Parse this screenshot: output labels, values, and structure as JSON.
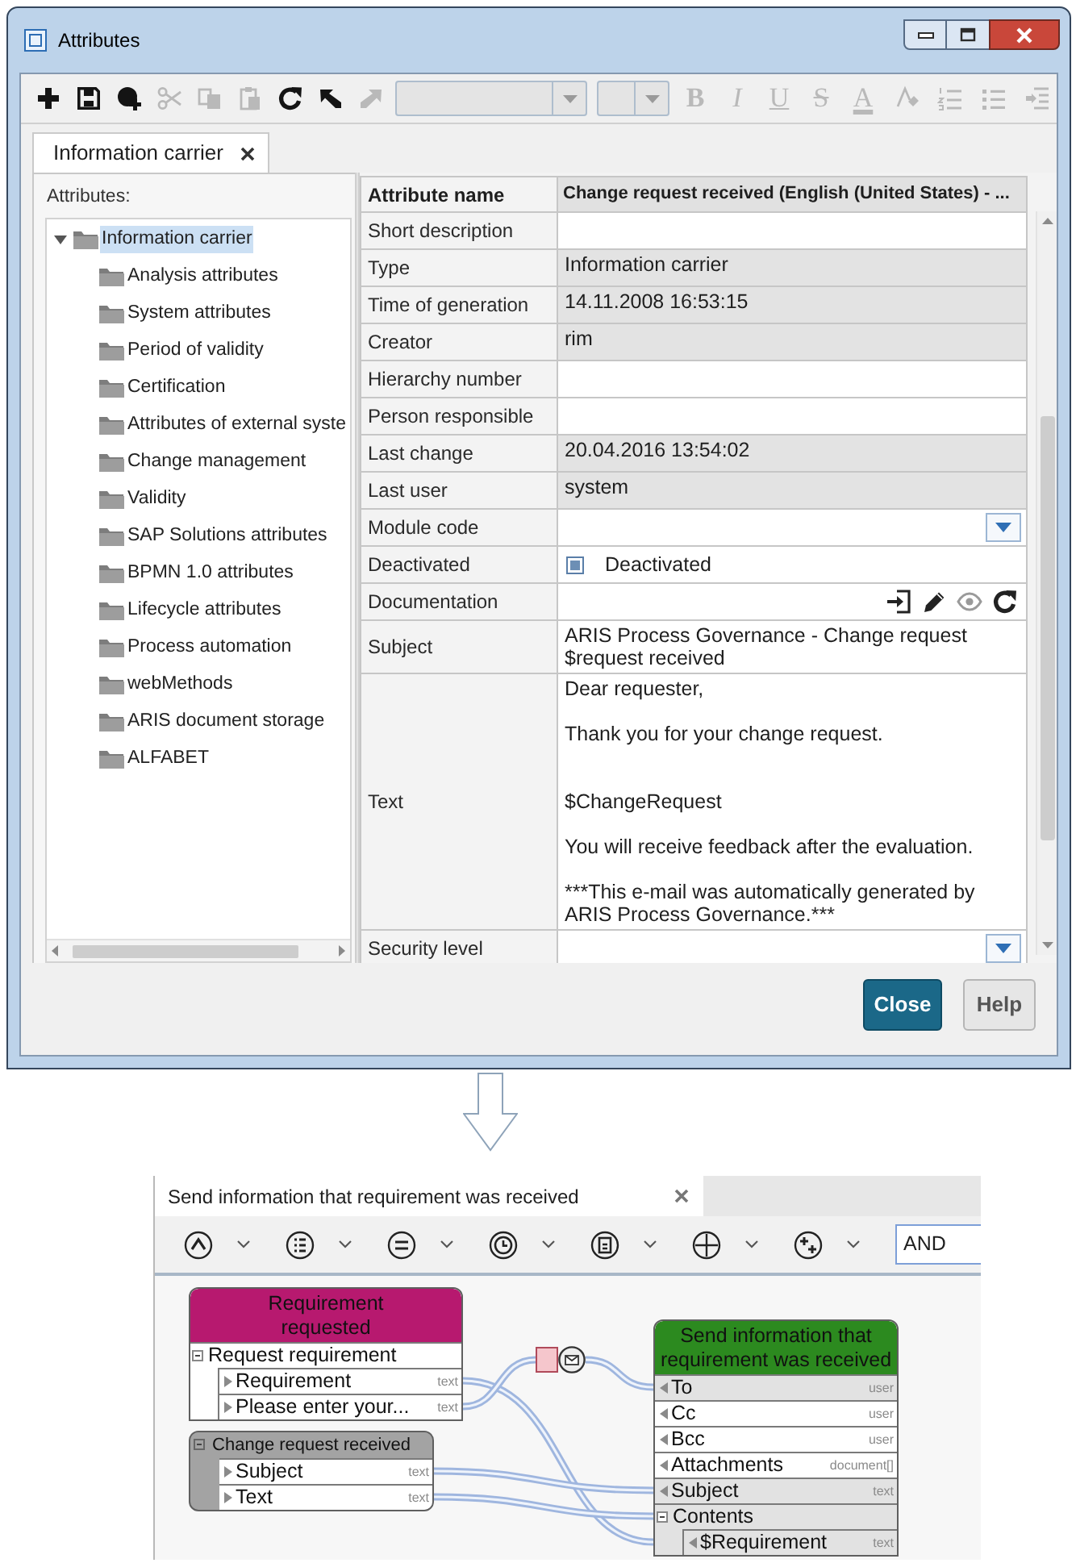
{
  "window": {
    "title": "Attributes"
  },
  "toolbar": [
    {
      "kind": "icon",
      "disabled": false
    },
    {
      "kind": "icon",
      "disabled": false
    },
    {
      "kind": "icon",
      "disabled": false
    },
    {
      "kind": "icon",
      "disabled": true
    },
    {
      "kind": "icon",
      "disabled": true
    },
    {
      "kind": "icon",
      "disabled": true
    },
    {
      "kind": "icon",
      "disabled": false
    },
    {
      "kind": "icon",
      "disabled": false
    },
    {
      "kind": "icon",
      "disabled": true
    },
    {
      "kind": "dropdown",
      "disabled": true
    },
    {
      "kind": "dropdown",
      "disabled": true
    },
    {
      "kind": "glyph",
      "text": "B",
      "disabled": true
    },
    {
      "kind": "glyph",
      "text": "I",
      "disabled": true
    },
    {
      "kind": "glyph",
      "text": "U",
      "disabled": true
    },
    {
      "kind": "glyph",
      "text": "S",
      "disabled": true
    },
    {
      "kind": "glyph",
      "text": "A",
      "disabled": true
    },
    {
      "kind": "icon",
      "disabled": true
    },
    {
      "kind": "icon",
      "disabled": true
    },
    {
      "kind": "icon",
      "disabled": true
    },
    {
      "kind": "icon",
      "disabled": true
    }
  ],
  "tabs": [
    {
      "label": "Information carrier",
      "selected": true
    }
  ],
  "tree": {
    "label": "Attributes:",
    "items": [
      {
        "label": "Information carrier",
        "expanded": true,
        "selected": true,
        "children": [
          {
            "label": "Analysis attributes",
            "selected": false
          },
          {
            "label": "System attributes",
            "selected": false
          },
          {
            "label": "Period of validity",
            "selected": false
          },
          {
            "label": "Certification",
            "selected": false
          },
          {
            "label": "Attributes of external syste",
            "selected": false
          },
          {
            "label": "Change management",
            "selected": false
          },
          {
            "label": "Validity",
            "selected": false
          },
          {
            "label": "SAP Solutions attributes",
            "selected": false
          },
          {
            "label": "BPMN 1.0 attributes",
            "selected": false
          },
          {
            "label": "Lifecycle attributes",
            "selected": false
          },
          {
            "label": "Process automation",
            "selected": false
          },
          {
            "label": "webMethods",
            "selected": false
          },
          {
            "label": "ARIS document storage",
            "selected": false
          },
          {
            "label": "ALFABET",
            "selected": false
          }
        ]
      }
    ]
  },
  "attributes": {
    "header": {
      "name": "Attribute name",
      "value": "Change request received (English (United States) - ..."
    },
    "rows": [
      {
        "name": "Short description",
        "kind": "text",
        "readonly": false
      },
      {
        "name": "Type",
        "kind": "text",
        "readonly": true,
        "value": "Information carrier"
      },
      {
        "name": "Time of generation",
        "kind": "text",
        "readonly": true,
        "value": "14.11.2008 16:53:15"
      },
      {
        "name": "Creator",
        "kind": "text",
        "readonly": true,
        "value": "rim"
      },
      {
        "name": "Hierarchy number",
        "kind": "text",
        "readonly": false
      },
      {
        "name": "Person responsible",
        "kind": "text",
        "readonly": false
      },
      {
        "name": "Last change",
        "kind": "text",
        "readonly": true,
        "value": "20.04.2016 13:54:02"
      },
      {
        "name": "Last user",
        "kind": "text",
        "readonly": true,
        "value": "system"
      },
      {
        "name": "Module code",
        "kind": "dropdown",
        "readonly": false
      },
      {
        "name": "Deactivated",
        "kind": "checkbox",
        "readonly": false,
        "indeterminate": true,
        "value": "Deactivated"
      },
      {
        "name": "Documentation",
        "kind": "document",
        "readonly": false
      },
      {
        "name": "Subject",
        "kind": "text",
        "readonly": false,
        "value": "ARIS Process Governance - Change request $request received"
      },
      {
        "name": "Text",
        "kind": "text",
        "readonly": false,
        "value": "Dear requester,\n\nThank you for your change request.\n\n\n$ChangeRequest\n\nYou will receive feedback after the evaluation.\n\n***This e-mail was automatically generated by ARIS Process Governance.***"
      },
      {
        "name": "Security level",
        "kind": "dropdown",
        "readonly": false
      }
    ]
  },
  "buttons": [
    {
      "label": "Close",
      "primary": true
    },
    {
      "label": "Help",
      "primary": false
    }
  ],
  "flow_editor": {
    "tabs": [
      {
        "label": "Send information that requirement was received",
        "selected": true
      }
    ],
    "toolbar": [
      {
        "kind": "menu"
      },
      {
        "kind": "menu"
      },
      {
        "kind": "menu"
      },
      {
        "kind": "menu"
      },
      {
        "kind": "menu"
      },
      {
        "kind": "menu"
      },
      {
        "kind": "menu"
      },
      {
        "kind": "combo",
        "value": "AND"
      }
    ],
    "nodes": [
      {
        "title": "Requirement requested",
        "color": "#b7196f",
        "kind": "output",
        "rows": [
          {
            "label": "Request requirement",
            "shaded": false,
            "expanded": true,
            "children": [
              {
                "label": "Requirement",
                "type": "text",
                "shaded": false
              },
              {
                "label": "Please enter your...",
                "type": "text",
                "shaded": false
              }
            ]
          }
        ]
      },
      {
        "title": "Change request received",
        "color": "#a3a3a3",
        "kind": "output",
        "expanded": true,
        "rows": [
          {
            "label": "Subject",
            "type": "text",
            "shaded": false
          },
          {
            "label": "Text",
            "type": "text",
            "shaded": false
          }
        ]
      },
      {
        "title": "Send information that requirement was received",
        "color": "#2c8a1f",
        "kind": "input",
        "rows": [
          {
            "label": "To",
            "type": "user",
            "shaded": true
          },
          {
            "label": "Cc",
            "type": "user",
            "shaded": false
          },
          {
            "label": "Bcc",
            "type": "user",
            "shaded": false
          },
          {
            "label": "Attachments",
            "type": "document[]",
            "shaded": false
          },
          {
            "label": "Subject",
            "type": "text",
            "shaded": true
          },
          {
            "label": "Contents",
            "shaded": true,
            "expanded": true,
            "children": [
              {
                "label": "$Requirement",
                "type": "text",
                "shaded": true
              }
            ]
          }
        ]
      }
    ]
  }
}
